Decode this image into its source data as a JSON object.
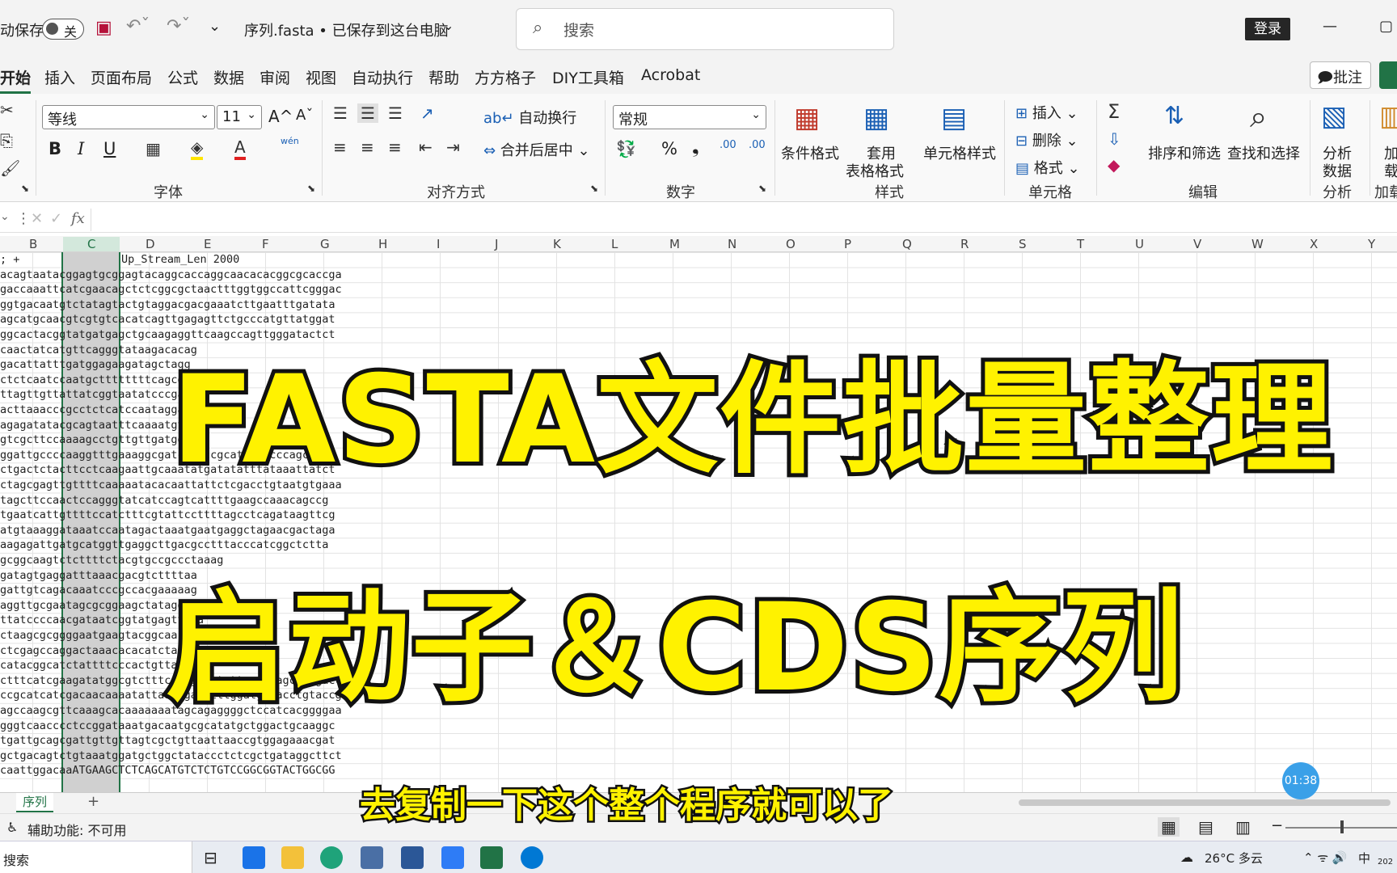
{
  "titlebar": {
    "autosave_label": "动保存",
    "autosave_state": "关",
    "doc_title": "序列.fasta • 已保存到这台电脑",
    "search_placeholder": "搜索",
    "login": "登录",
    "win_min": "—",
    "win_restore": "▢"
  },
  "menu": [
    "开始",
    "插入",
    "页面布局",
    "公式",
    "数据",
    "审阅",
    "视图",
    "自动执行",
    "帮助",
    "方方格子",
    "DIY工具箱",
    "Acrobat"
  ],
  "comment_button": "批注",
  "ribbon": {
    "font_name": "等线",
    "font_size": "11",
    "grow_font": "A^",
    "shrink_font": "Aˇ",
    "bold": "B",
    "italic": "I",
    "underline": "U",
    "phonetic": "wén",
    "font_group": "字体",
    "wrap_text": "自动换行",
    "merge_center": "合并后居中",
    "align_group": "对齐方式",
    "number_format": "常规",
    "percent": "%",
    "comma": "❟",
    "inc_decimal": ".00",
    "dec_decimal": ".00",
    "number_group": "数字",
    "cond_format": "条件格式",
    "table_format_1": "套用",
    "table_format_2": "表格格式",
    "cell_styles": "单元格样式",
    "styles_group": "样式",
    "insert": "插入",
    "delete": "删除",
    "format": "格式",
    "cells_group": "单元格",
    "sort_filter": "排序和筛选",
    "find_select": "查找和选择",
    "edit_group": "编辑",
    "analyze_1": "分析",
    "analyze_2": "数据",
    "analyze_group": "分析",
    "addin_1": "加",
    "addin_2": "载",
    "addin_group": "加载"
  },
  "formula": {
    "fx": "fx"
  },
  "columns": [
    "B",
    "C",
    "D",
    "E",
    "F",
    "G",
    "H",
    "I",
    "J",
    "K",
    "L",
    "M",
    "N",
    "O",
    "P",
    "Q",
    "R",
    "S",
    "T",
    "U",
    "V",
    "W",
    "X",
    "Y"
  ],
  "header_row": {
    "a": "; +",
    "d": "Up_Stream_Len 2000"
  },
  "rows": [
    "acagtaatacggagtgcggagtacaggcaccaggcaacacacggcgcaccga",
    "gaccaaattcatcgaacagctctcggcgctaactttggtggccattcgggac",
    "ggtgacaatgtctatagtactgtaggacgacgaaatcttgaatttgatata",
    "agcatgcaacgtcgtgtcacatcagttgagagttctgcccatgttatggat",
    "ggcactacggtatgatgagctgcaagaggttcaagccagttgggatactct",
    "caactatcatgttcagggtataagacacag",
    "gacattatttgatggagaagatagctagg",
    "ctctcaatccaatgcttttttttcagcgcta",
    "ttagttgttattatcggtaatatcccgatca",
    "acttaaacccgcctctcatccaataggat",
    "agagatatacgcagtaatttcaaaatgtt",
    "gtcgcttccaaaagcctgttgttgatggtg",
    "ggattgccccaaggtttgaaaggcgatcataccgcatacaccccagccatc",
    "ctgactctacttcctcaagaattgcaaatatgatatatttataaattatct",
    "ctagcgagttgttttcaaaaatacacaattattctcgacctgtaatgtgaaa",
    "tagcttccaactccagggtatcatccagtcattttgaagccaaacagccg",
    "tgaatcattgttttccatctttcgtattccttttagcctcagataagttcg",
    "atgtaaaggataaatccaatagactaaatgaatgaggctagaacgactaga",
    "aagagattgatgcatggttgaggcttgacgcctttacccatcggctctta",
    "gcggcaagtctcttttctacgtgccgccctaaag",
    "gatagtgaggatttaaacgacgtcttttaa",
    "gattgtcagacaaatcccgccacgaaaaag",
    "aggttgcgaatagcgcggaagctatagg",
    "ttatccccaacgataatcggtatgagttgca",
    "ctaagcgcggggaatgaagtacggcaa",
    "ctcgagccaggactaaacacacatcta",
    "catacggcatctattttcccactgttaagt",
    "ctttcatcgaagatatggcgtctttcactgcgatgttggaatagctttgaccg",
    "ccgcatcatcgacaacaaaatattaaatgatctttggatgaaacctgtaccg",
    "agccaagcgttcaaagcacaaaaaaatagcagaggggctccatcacggggaa",
    "gggtcaacccctccggataaatgacaatgcgcatatgctggactgcaaggc",
    "tgattgcagcgattgttgttagtcgctgttaattaaccgtggagaaacgat",
    "gctgacagtctgtaaatggatgctggctataccctctcgctgataggcttct",
    "caattggacaaATGAAGCTCTCAGCATGTCTCTGTCCGGCGGTACTGGCGG"
  ],
  "overlay": {
    "line1": "FASTA文件批量整理",
    "line2": "启动子＆CDS序列"
  },
  "subtitle": "去复制一下这个整个程序就可以了",
  "timer": "01:38",
  "sheet_tab": "序列",
  "add_sheet": "+",
  "status": {
    "accessibility": "辅助功能: 不可用"
  },
  "taskbar": {
    "search": "搜索",
    "weather": "26°C 多云",
    "ime": "中",
    "clock_hint": "202"
  }
}
